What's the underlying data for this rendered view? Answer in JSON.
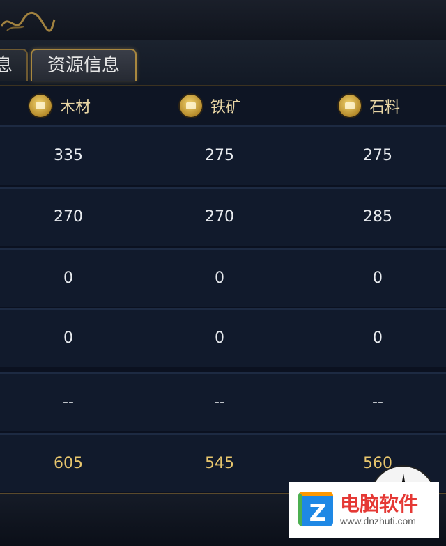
{
  "tabs": [
    {
      "label": "息"
    },
    {
      "label": "资源信息"
    }
  ],
  "columns": [
    {
      "label": "木材",
      "icon": "wood-icon"
    },
    {
      "label": "铁矿",
      "icon": "iron-icon"
    },
    {
      "label": "石料",
      "icon": "stone-icon"
    }
  ],
  "rows": [
    [
      "335",
      "275",
      "275"
    ],
    [
      "270",
      "270",
      "285"
    ],
    [
      "0",
      "0",
      "0"
    ],
    [
      "0",
      "0",
      "0"
    ],
    [
      "--",
      "--",
      "--"
    ]
  ],
  "total": [
    "605",
    "545",
    "560"
  ],
  "watermark": {
    "title": "电脑软件",
    "url": "www.dnzhuti.com",
    "logo_letter": "Z"
  },
  "colors": {
    "accent_gold": "#e8c66d",
    "background": "#0b1120"
  }
}
